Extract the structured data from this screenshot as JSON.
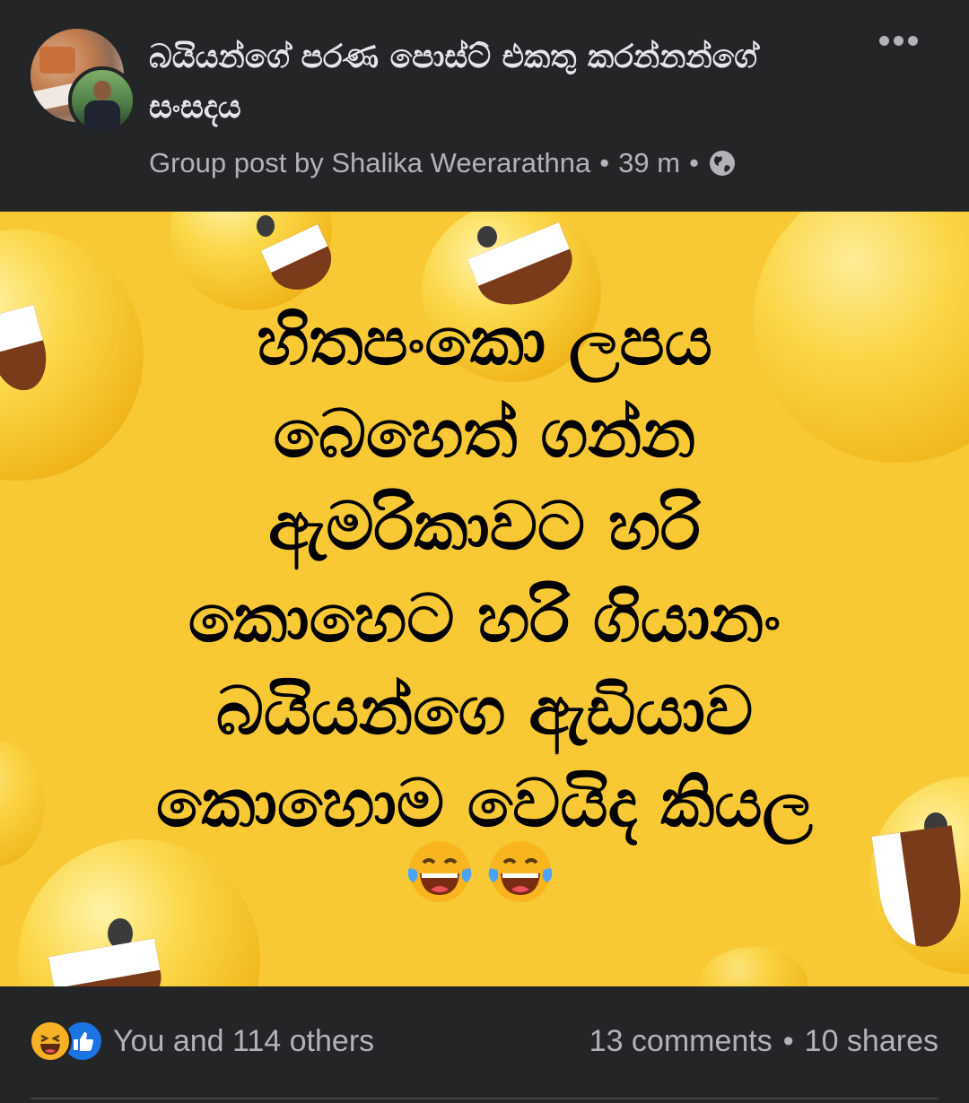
{
  "header": {
    "group_name": "බයියන්ගේ පරණ පොස්ට් එකතු කරන්නන්ගේ සංසදය",
    "meta_prefix": "Group post by",
    "author": "Shalika Weerarathna",
    "time": "39 m",
    "separator": "•",
    "privacy_icon": "globe-icon",
    "more_icon": "more-horizontal-icon"
  },
  "post": {
    "lines": [
      "හිතපංකො ලපය",
      "බෙහෙත් ගන්න",
      "ඇමරිකාවට හරි",
      "කොහෙට හරි ගියානං",
      "බයියන්ගෙ ඇඩියාව",
      "කොහොම වෙයිද කියල"
    ],
    "emojis": [
      "face-with-tears-of-joy-icon",
      "face-with-tears-of-joy-icon"
    ],
    "background_color": "#f8c935"
  },
  "footer": {
    "reaction_icons": [
      "haha-icon",
      "like-icon"
    ],
    "reactions_text": "You and 114 others",
    "comments": "13 comments",
    "shares": "10 shares",
    "separator": "•"
  },
  "colors": {
    "background": "#242526",
    "primary_text": "#e4e6eb",
    "secondary_text": "#b0b3b8",
    "like_blue": "#1b74e4",
    "haha_yellow": "#f7b125"
  }
}
